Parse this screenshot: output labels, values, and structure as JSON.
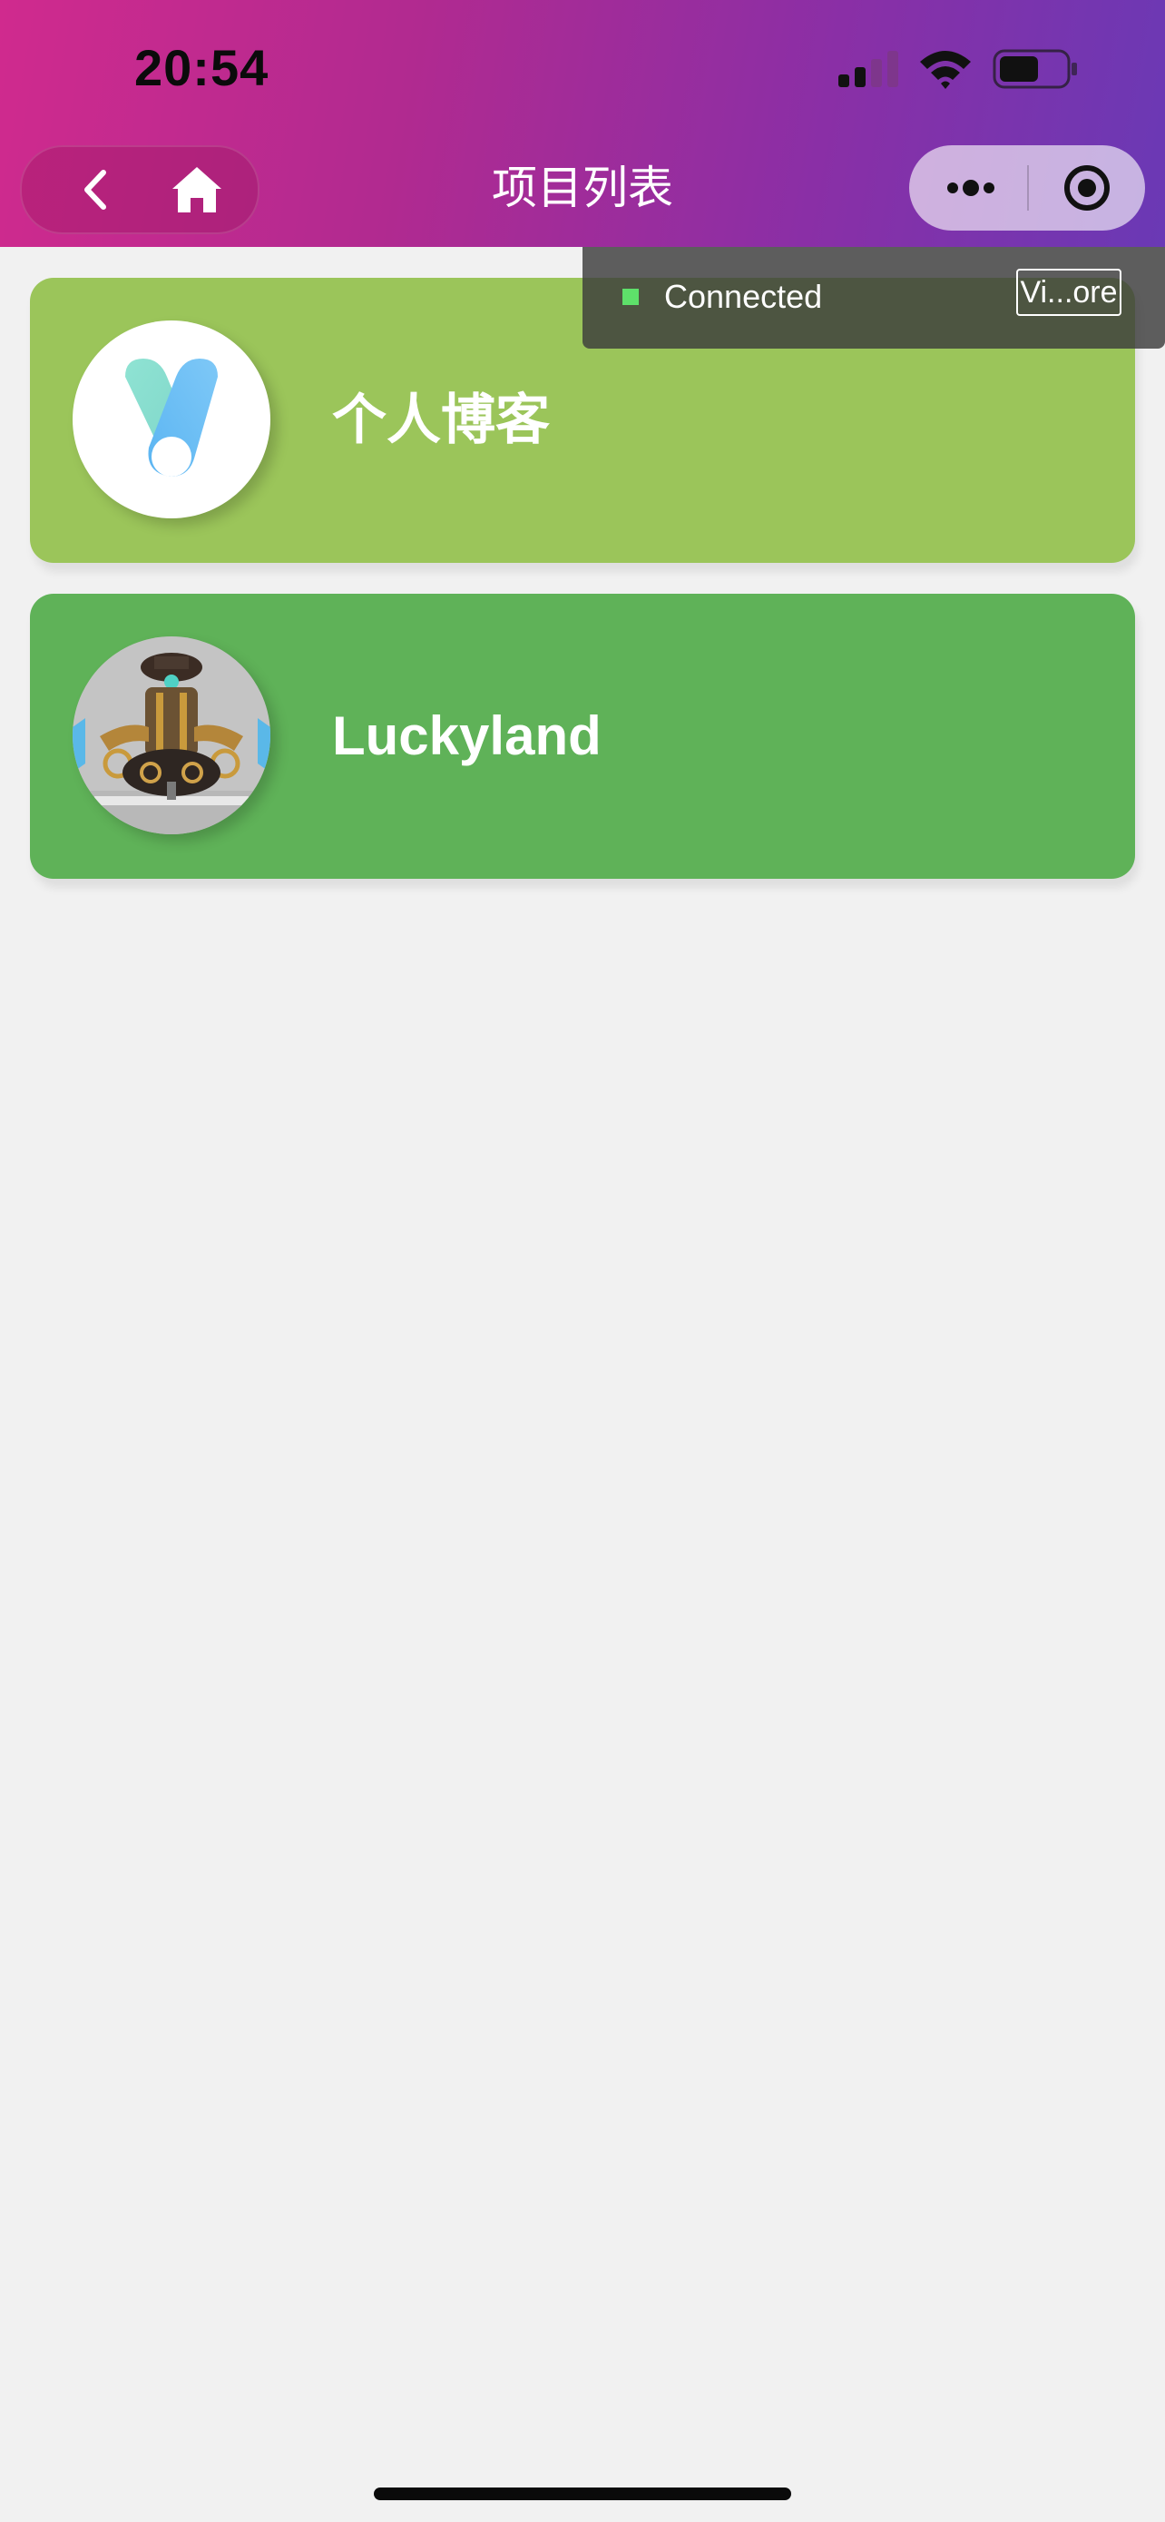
{
  "status_bar": {
    "time": "20:54",
    "icons": [
      "cellular-signal-icon",
      "wifi-icon",
      "battery-icon"
    ]
  },
  "nav": {
    "title": "项目列表",
    "left_capsule": {
      "icons": [
        "back-chevron-icon",
        "home-icon"
      ]
    },
    "right_capsule": {
      "icons": [
        "more-dots-icon",
        "close-target-icon"
      ]
    }
  },
  "projects": [
    {
      "title": "个人博客",
      "avatar_icon": "blog-logo-icon",
      "card_color": "#9bc55a"
    },
    {
      "title": "Luckyland",
      "avatar_icon": "steampunk-robot-avatar",
      "card_color": "#5fb258"
    }
  ],
  "vconsole": {
    "status": "Connected",
    "button_label": "Vi...ore",
    "status_color": "#5ee06a"
  },
  "colors": {
    "header_gradient_start": "#d02a8e",
    "header_gradient_end": "#6a39b5",
    "background": "#f1f1f1"
  }
}
